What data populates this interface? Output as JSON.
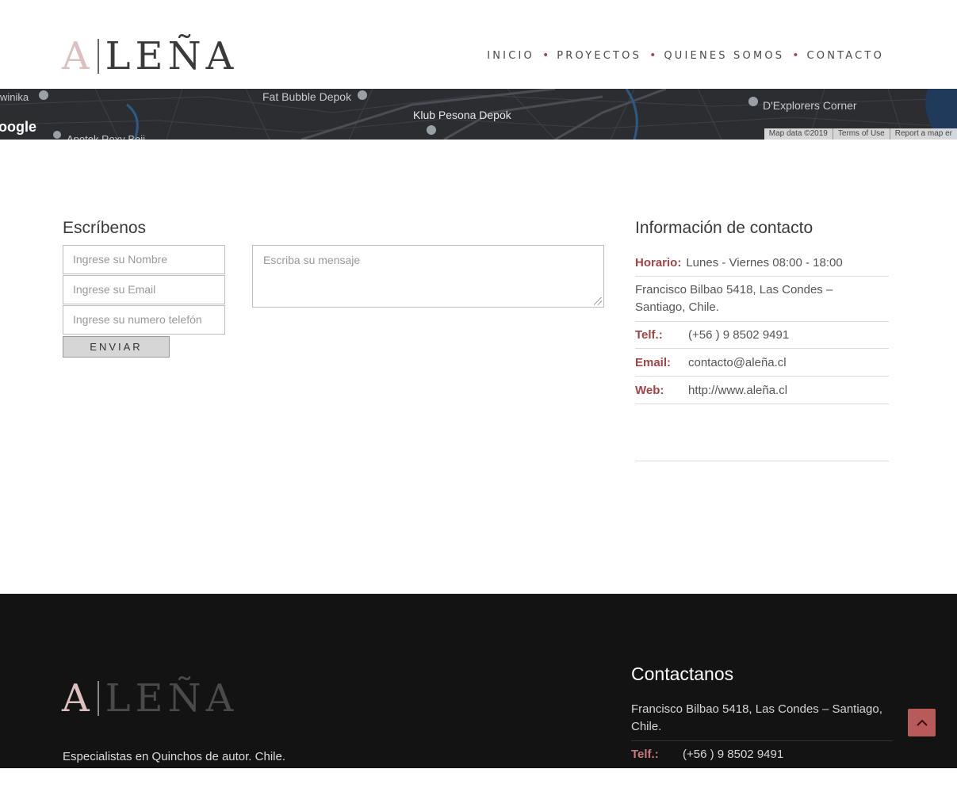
{
  "brand": {
    "logo_initial": "A",
    "logo_rest": "LEÑA"
  },
  "nav": {
    "items": [
      "INICIO",
      "PROYECTOS",
      "QUIENES SOMOS",
      "CONTACTO"
    ],
    "separator": "•"
  },
  "map": {
    "labels": [
      "winika",
      "Fat Bubble Depok",
      "Klub Pesona Depok",
      "D'Explorers Corner",
      "Apotek Roxy Beji"
    ],
    "google": "oogle",
    "footer": [
      "Map data ©2019",
      "Terms of Use",
      "Report a map er"
    ]
  },
  "form": {
    "title": "Escríbenos",
    "name_placeholder": "Ingrese su Nombre",
    "email_placeholder": "Ingrese su Email",
    "phone_placeholder": "Ingrese su numero telefón",
    "message_placeholder": "Escriba su mensaje",
    "submit_label": "ENVIAR"
  },
  "contact_info": {
    "title": "Información de contacto",
    "hours_label": "Horario:",
    "hours_value": "Lunes - Viernes 08:00 - 18:00",
    "address": "Francisco Bilbao 5418, Las Condes – Santiago, Chile.",
    "phone_label": "Telf.:",
    "phone_value": "(+56 ) 9 8502 9491",
    "email_label": "Email:",
    "email_value": "contacto@aleña.cl",
    "web_label": "Web:",
    "web_value": "http://www.aleña.cl"
  },
  "footer": {
    "tagline": "Especialistas en Quinchos de autor. Chile.",
    "contact_title": "Contactanos",
    "address": "Francisco Bilbao 5418, Las Condes – Santiago, Chile.",
    "phone_label": "Telf.:",
    "phone_value": "(+56 ) 9 8502 9491"
  },
  "colors": {
    "accent": "#9e4545",
    "logo_initial": "#dcbfbe",
    "footer_bg": "#131313",
    "back_to_top": "#b95a5a"
  }
}
